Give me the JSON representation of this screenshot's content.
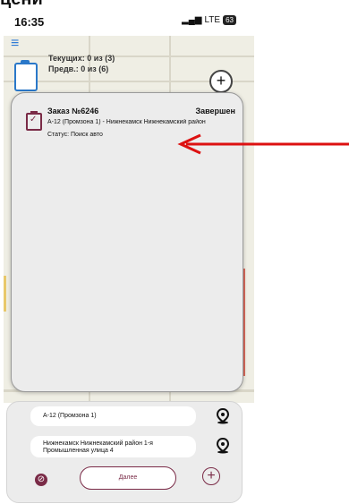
{
  "status_bar": {
    "time": "16:35",
    "network": "LTE",
    "battery": "63"
  },
  "summary": {
    "current": "Текущих: 0 из (3)",
    "previous": "Предв.: 0 из (6)"
  },
  "order": {
    "title": "Заказ №6246",
    "state": "Завершен",
    "route": "А-12 (Промзона 1) - Нижнекамск Нижнекамский район",
    "status": "Статус: Поиск авто"
  },
  "form": {
    "from": "А-12 (Промзона 1)",
    "to_line1": "Нижнекамск Нижнекамский район 1-я",
    "to_line2": "Промышленная улица 4",
    "next_label": "Далее"
  },
  "colors": {
    "accent": "#7a2b47",
    "annotation_arrow": "#d11"
  }
}
